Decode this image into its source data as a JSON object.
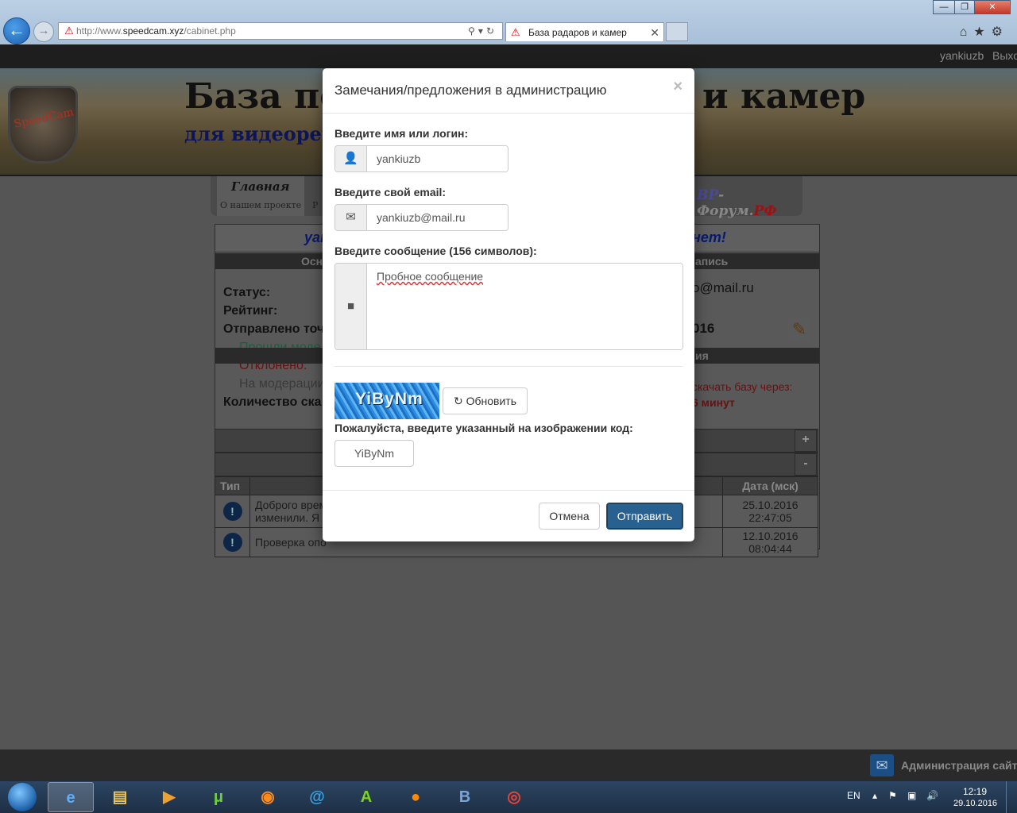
{
  "browser": {
    "url_prefix": "http://www.",
    "url_domain": "speedcam.xyz",
    "url_path": "/cabinet.php",
    "tab_title": "База радаров и камер",
    "tab_close": "✕"
  },
  "site": {
    "user_link": "yankiuzb",
    "logout_link": "Выход",
    "title_part1": "База по",
    "title_part2": "и камер",
    "subtitle": "для видеорег",
    "logo_text": "SpeedCam",
    "menu_main": "Главная",
    "menu_main_sub": "О нашем проекте",
    "menu_next": "Р",
    "forum_a": "ВР",
    "forum_b": "- Форум.",
    "forum_c": "РФ"
  },
  "cabinet": {
    "user_partial": "yan",
    "greet_tail": "нет!",
    "band1_left": "Осн",
    "band1_right": "апись",
    "status_label": "Статус:",
    "rating_label": "Рейтинг:",
    "sent_label": "Отправлено точ",
    "approved_label": "Прошли моде",
    "rejected_label": "Отклонено:",
    "moderation_label": "На модерации",
    "downloads_label": "Количество ска",
    "email_tail": "o@mail.ru",
    "date_tail": "016",
    "band2_right": "ия",
    "download_note": "скачать базу через:",
    "download_time": "6 минут",
    "plus": "+",
    "minus": "-"
  },
  "log_table": {
    "headers": [
      "Тип",
      "",
      "Дата (мск)"
    ],
    "rows": [
      {
        "text1": "Доброго време",
        "text2": "изменили. Я н",
        "date": "25.10.2016 22:47:05"
      },
      {
        "text1": "Проверка опо",
        "text2": "",
        "date": "12.10.2016 08:04:44"
      }
    ]
  },
  "footer": {
    "admin_text": "Администрация сайт"
  },
  "modal": {
    "title": "Замечания/предложения в администрацию",
    "close": "×",
    "name_label": "Введите имя или логин:",
    "name_value": "yankiuzb",
    "email_label": "Введите свой email:",
    "email_value": "yankiuzb@mail.ru",
    "message_label": "Введите сообщение (156 символов):",
    "message_value": "Пробное сообщение",
    "captcha_text": "YiByNm",
    "refresh_label": "Обновить",
    "code_label": "Пожалуйста, введите указанный на изображении код:",
    "code_value": "YiByNm",
    "cancel_label": "Отмена",
    "submit_label": "Отправить"
  },
  "taskbar": {
    "lang": "EN",
    "time": "12:19",
    "date": "29.10.2016",
    "apps": [
      "internet-explorer",
      "file-explorer",
      "media-player",
      "utorrent",
      "firefox",
      "mail-agent",
      "aptoide",
      "odnoklassniki",
      "vkontakte",
      "chrome"
    ]
  },
  "colors": {
    "primary_button": "#286090",
    "page_overlay": "#555555",
    "captcha_blue": "#2a8be0"
  }
}
